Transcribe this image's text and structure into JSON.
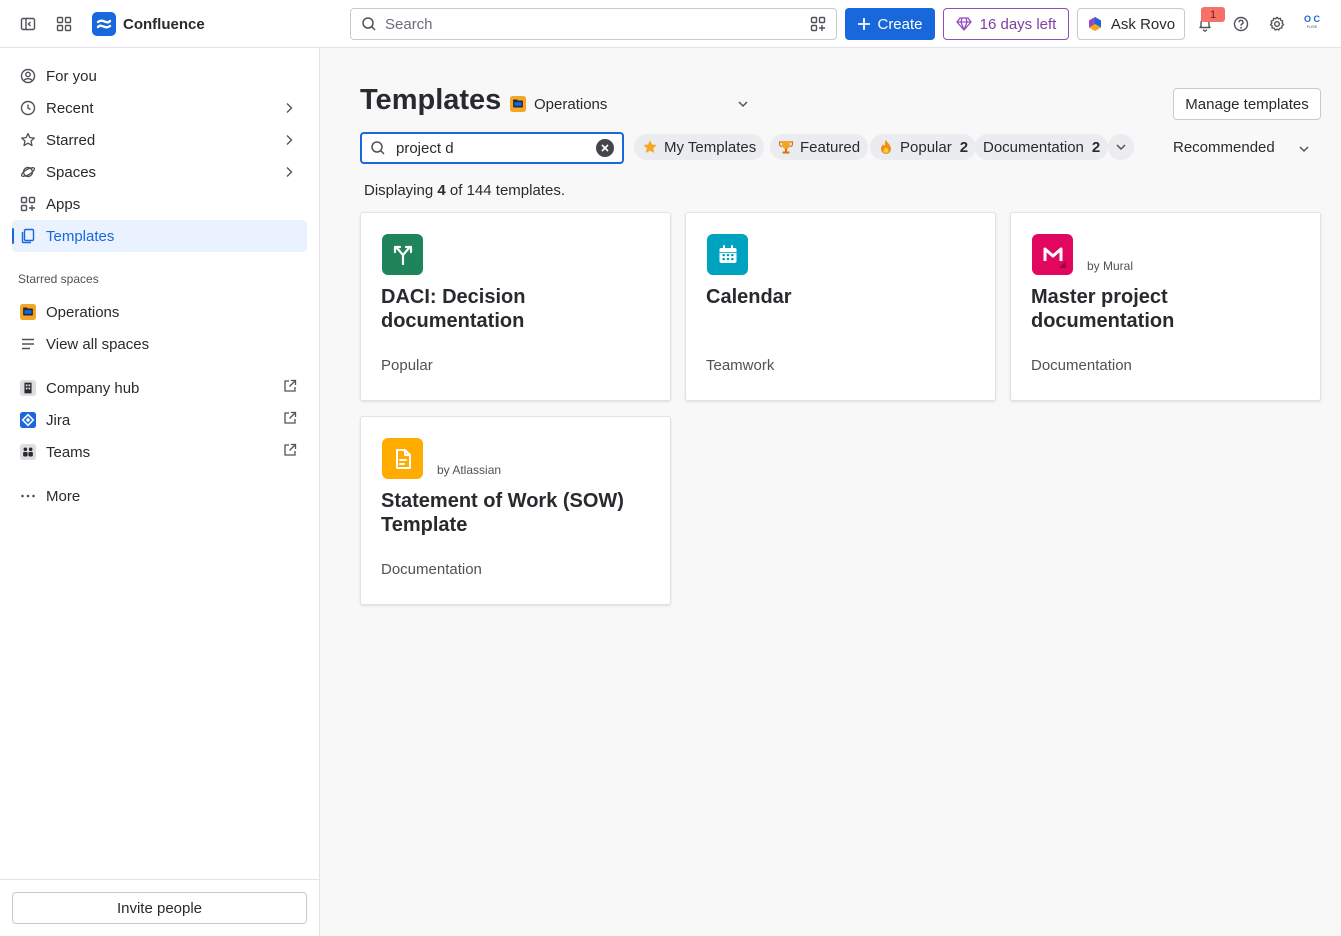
{
  "topbar": {
    "app_name": "Confluence",
    "search_placeholder": "Search",
    "create_label": "Create",
    "trial_label": "16 days left",
    "rovo_label": "Ask Rovo",
    "notifications_count": "1",
    "avatar_initials": "O C",
    "avatar_subtext": "FUSE"
  },
  "sidebar": {
    "items": [
      {
        "label": "For you"
      },
      {
        "label": "Recent"
      },
      {
        "label": "Starred"
      },
      {
        "label": "Spaces"
      },
      {
        "label": "Apps"
      },
      {
        "label": "Templates"
      }
    ],
    "starred_spaces_label": "Starred spaces",
    "spaces": [
      {
        "label": "Operations"
      },
      {
        "label": "View all spaces"
      }
    ],
    "apps": [
      {
        "label": "Company hub"
      },
      {
        "label": "Jira"
      },
      {
        "label": "Teams"
      }
    ],
    "more_label": "More",
    "invite_label": "Invite people"
  },
  "main": {
    "title": "Templates",
    "space_selected": "Operations",
    "manage_label": "Manage templates",
    "search_value": "project d",
    "chips": [
      {
        "label": "My Templates",
        "count": ""
      },
      {
        "label": "Featured",
        "count": ""
      },
      {
        "label": "Popular",
        "count": "2"
      },
      {
        "label": "Documentation",
        "count": "2"
      }
    ],
    "sort_selected": "Recommended",
    "displaying_prefix": "Displaying",
    "displaying_count": "4",
    "displaying_middle": "of",
    "displaying_total": "144",
    "displaying_suffix": "templates.",
    "cards": [
      {
        "title": "DACI: Decision documentation",
        "category": "Popular",
        "by": "",
        "color": "#1f845a"
      },
      {
        "title": "Calendar",
        "category": "Teamwork",
        "by": "",
        "color": "#00a3bf"
      },
      {
        "title": "Master project documentation",
        "category": "Documentation",
        "by": "by Mural",
        "color": "#e2075e"
      },
      {
        "title": "Statement of Work (SOW) Template",
        "category": "Documentation",
        "by": "by Atlassian",
        "color": "#ffab00"
      }
    ]
  },
  "colors": {
    "accent": "#1868db",
    "trial": "#964ac0",
    "space_icon": "#f5a623"
  }
}
